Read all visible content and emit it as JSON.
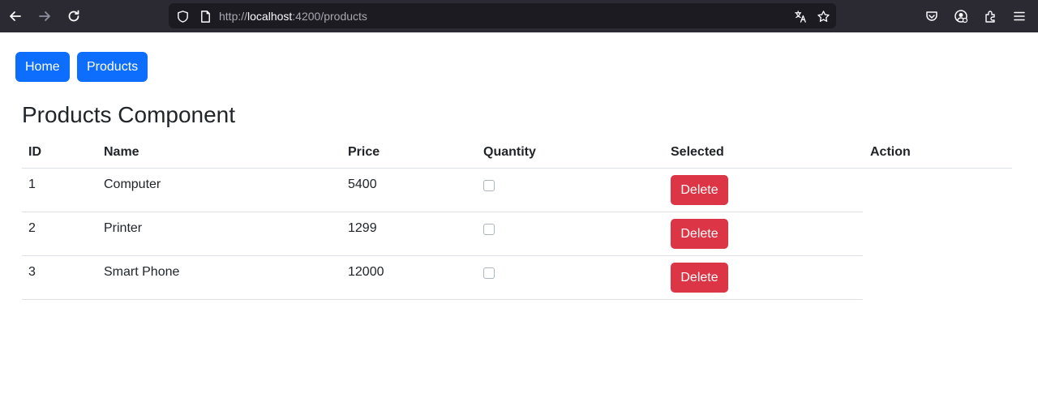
{
  "browser": {
    "url_scheme": "http://",
    "url_host": "localhost",
    "url_rest": ":4200/products",
    "toolbar_bg": "#2b2a33",
    "urlbar_bg": "#1c1b22"
  },
  "nav": {
    "home_label": "Home",
    "products_label": "Products",
    "button_color": "#0d6efd"
  },
  "page_title": "Products Component",
  "table": {
    "headers": [
      "ID",
      "Name",
      "Price",
      "Quantity",
      "Selected",
      "Action"
    ],
    "rows": [
      {
        "id": "1",
        "name": "Computer",
        "price": "5400",
        "selected": false,
        "action": "Delete"
      },
      {
        "id": "2",
        "name": "Printer",
        "price": "1299",
        "selected": false,
        "action": "Delete"
      },
      {
        "id": "3",
        "name": "Smart Phone",
        "price": "12000",
        "selected": false,
        "action": "Delete"
      }
    ],
    "delete_color": "#dc3545"
  },
  "icons": [
    "back-arrow-icon",
    "forward-arrow-icon",
    "reload-icon",
    "shield-icon",
    "page-icon",
    "translate-icon",
    "bookmark-star-icon",
    "pocket-icon",
    "account-icon",
    "extensions-icon",
    "menu-icon"
  ]
}
